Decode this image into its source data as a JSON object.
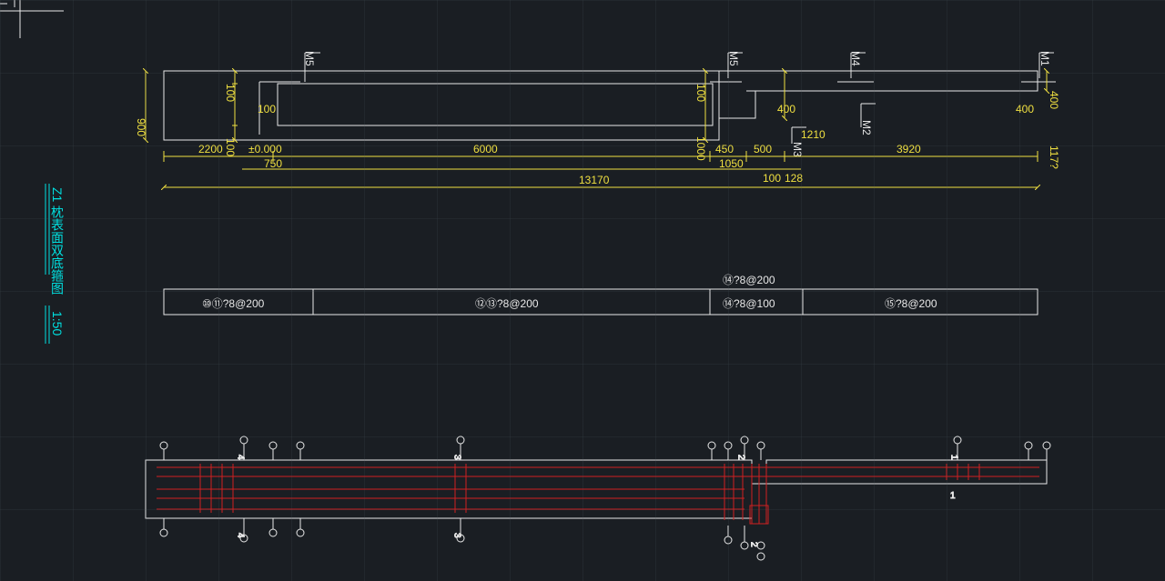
{
  "title": "Z1 枕表面双底箍图",
  "scale": "1:50",
  "dimensions": {
    "left_height": "900",
    "top_gap_left": "100",
    "mid_gap_left": "100",
    "bot_gap_left": "100",
    "small_left": "100",
    "bottom_left": "2200",
    "small_sub": "±0.000",
    "small_750": "750",
    "center_span": "6000",
    "right_top_gap": "100",
    "right_1000": "1000",
    "seg_450": "450",
    "seg_500": "500",
    "seg_1050": "1050",
    "seg_100": "100",
    "seg_128": "128",
    "right_400a": "400",
    "right_400b": "400",
    "right_400c": "400",
    "right_3920": "3920",
    "seg_1210": "1210",
    "total": "13170",
    "tiny_right": "117?"
  },
  "callouts": {
    "m1": "M1",
    "m2": "M2",
    "m3": "M3",
    "m4": "M4",
    "m5a": "M5",
    "m5b": "M5"
  },
  "rebar_row": {
    "cell1": "⑩⑪?8@200",
    "cell2": "⑫⑬?8@200",
    "cell3_top": "⑭?8@200",
    "cell3": "⑭?8@100",
    "cell4": "⑮?8@200"
  },
  "section_marks": {
    "s1": "1",
    "s2": "2",
    "s3": "3",
    "s4": "4"
  }
}
